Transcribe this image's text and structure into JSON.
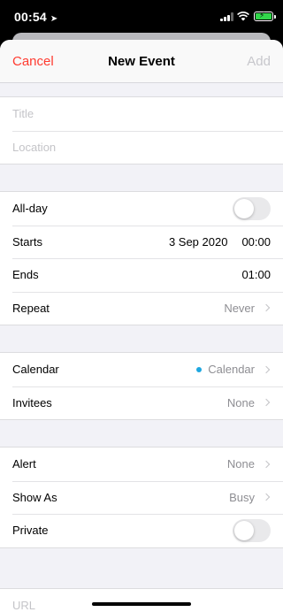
{
  "status_bar": {
    "time": "00:54"
  },
  "nav": {
    "cancel": "Cancel",
    "title": "New Event",
    "add": "Add"
  },
  "fields": {
    "title_placeholder": "Title",
    "location_placeholder": "Location",
    "url_placeholder": "URL"
  },
  "event": {
    "all_day_label": "All-day",
    "all_day_on": false,
    "starts_label": "Starts",
    "starts_date": "3 Sep 2020",
    "starts_time": "00:00",
    "ends_label": "Ends",
    "ends_time": "01:00",
    "repeat_label": "Repeat",
    "repeat_value": "Never"
  },
  "calendar": {
    "calendar_label": "Calendar",
    "calendar_value": "Calendar",
    "calendar_color": "#1ea7e0",
    "invitees_label": "Invitees",
    "invitees_value": "None"
  },
  "options": {
    "alert_label": "Alert",
    "alert_value": "None",
    "show_as_label": "Show As",
    "show_as_value": "Busy",
    "private_label": "Private",
    "private_on": false
  },
  "colors": {
    "accent": "#ff3b30",
    "background": "#f2f2f7",
    "disabled": "#c7c7cc"
  }
}
